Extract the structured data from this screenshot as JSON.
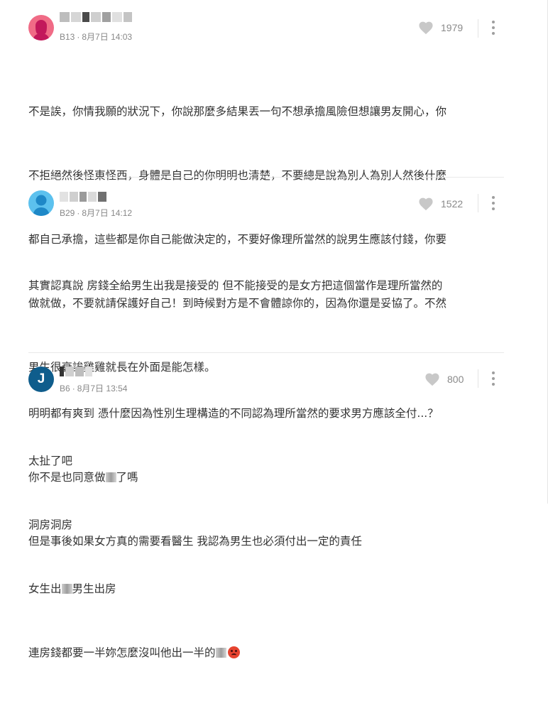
{
  "colors": {
    "divider": "#e9e9e9",
    "meta_text": "#888888",
    "body_text": "#333333",
    "heart": "#c8c8c8"
  },
  "comments": [
    {
      "floor": "B13",
      "date": "8月7日",
      "time": "14:03",
      "likes": "1979",
      "avatar": {
        "type": "female-silhouette",
        "bg": "#f06b86"
      },
      "lines": [
        "不是誒，你情我願的狀況下，你說那麼多結果丟一句不想承擔風險但想讓男友開心，你",
        "不拒絕然後怪東怪西，身體是自己的你明明也清楚，不要總是說為別人為別人然後什麼",
        "都自己承擔，這些都是你自己能做決定的，不要好像理所當然的說男生應該付錢，你要",
        "做就做，不要就請保護好自己！到時候對方是不會體諒你的，因為你還是妥協了。不然",
        "男生很衰誒雞雞就長在外面是能怎樣。"
      ]
    },
    {
      "floor": "B29",
      "date": "8月7日",
      "time": "14:12",
      "likes": "1522",
      "avatar": {
        "type": "male-silhouette",
        "bg": "#5cc1ee"
      },
      "lines": [
        "其實認真說 房錢全給男生出我是接受的 但不能接受的是女方把這個當作是理所當然的",
        "",
        "明明都有爽到 憑什麼因為性別生理構造的不同認為理所當然的要求男方應該全付...？",
        "你不是也同意做",
        "但是事後如果女方真的需要看醫生 我認為男生也必須付出一定的責任"
      ],
      "line4_suffix": "了嗎"
    },
    {
      "floor": "B6",
      "date": "8月7日",
      "time": "13:54",
      "likes": "800",
      "avatar": {
        "type": "letter",
        "letter": "J",
        "bg": "#0f5d8c"
      },
      "lines": [
        "太扯了吧",
        "洞房洞房",
        "女生出",
        "連房錢都要一半妳怎麼沒叫他出一半的"
      ],
      "line3_suffix": "男生出房"
    }
  ]
}
